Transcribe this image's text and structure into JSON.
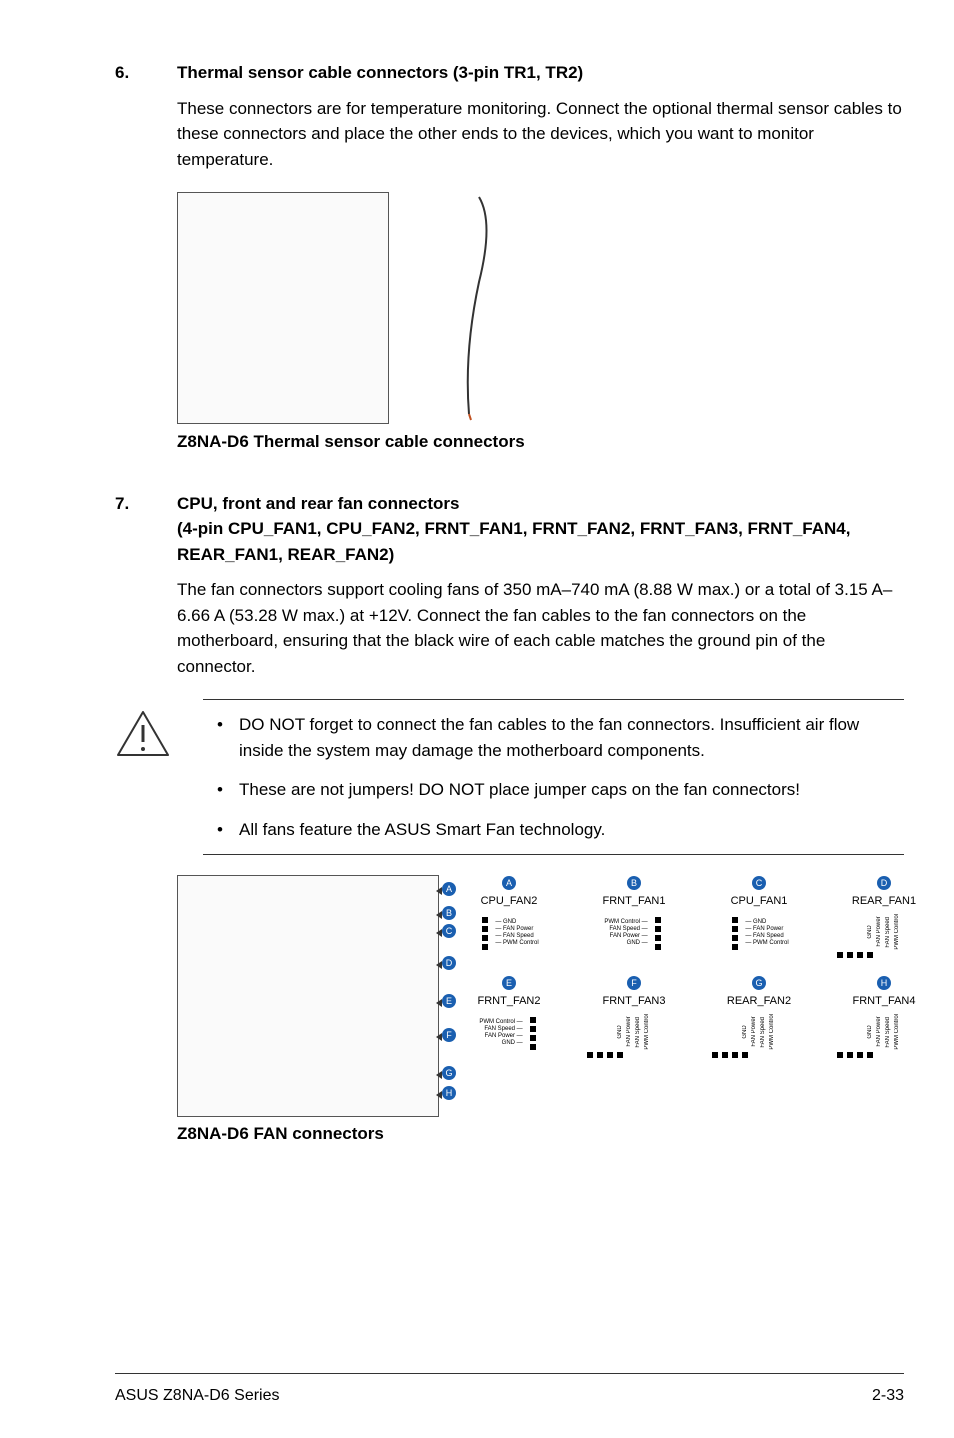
{
  "sec6": {
    "num": "6.",
    "title": "Thermal sensor cable connectors (3-pin TR1, TR2)",
    "body": "These connectors are for temperature monitoring. Connect the optional thermal sensor cables to these connectors and place the other ends to the devices, which you want to monitor temperature.",
    "caption": "Z8NA-D6 Thermal sensor cable connectors"
  },
  "sec7": {
    "num": "7.",
    "title1": "CPU, front and rear fan connectors",
    "title2": "(4-pin CPU_FAN1, CPU_FAN2, FRNT_FAN1, FRNT_FAN2, FRNT_FAN3, FRNT_FAN4, REAR_FAN1, REAR_FAN2)",
    "body": "The fan connectors support cooling fans of 350 mA–740 mA (8.88 W max.) or a total of 3.15 A–6.66 A (53.28 W max.) at +12V. Connect the fan cables to the fan connectors on the motherboard, ensuring that the black wire of each cable matches the ground pin of the connector.",
    "caption": "Z8NA-D6 FAN connectors"
  },
  "notes": {
    "item1": "DO NOT forget to connect the fan cables to the fan connectors. Insufficient air flow inside the system may damage the motherboard components.",
    "item2": "These are not jumpers! DO NOT place jumper caps on the fan connectors!",
    "item3": "All fans feature the ASUS Smart Fan technology."
  },
  "fans": {
    "row1": [
      {
        "badge": "A",
        "label": "CPU_FAN2",
        "pins": [
          "GND",
          "FAN Power",
          "FAN Speed",
          "PWM Control"
        ],
        "orient": "v-left"
      },
      {
        "badge": "B",
        "label": "FRNT_FAN1",
        "pins": [
          "PWM Control",
          "FAN Speed",
          "FAN Power",
          "GND"
        ],
        "orient": "v-right"
      },
      {
        "badge": "C",
        "label": "CPU_FAN1",
        "pins": [
          "GND",
          "FAN Power",
          "FAN Speed",
          "PWM Control"
        ],
        "orient": "v-left"
      },
      {
        "badge": "D",
        "label": "REAR_FAN1",
        "pins": [
          "GND",
          "FAN Power",
          "FAN Speed",
          "PWM Control"
        ],
        "orient": "h"
      }
    ],
    "row2": [
      {
        "badge": "E",
        "label": "FRNT_FAN2",
        "pins": [
          "PWM Control",
          "FAN Speed",
          "FAN Power",
          "GND"
        ],
        "orient": "v-right"
      },
      {
        "badge": "F",
        "label": "FRNT_FAN3",
        "pins": [
          "GND",
          "FAN Power",
          "FAN Speed",
          "PWM Control"
        ],
        "orient": "h"
      },
      {
        "badge": "G",
        "label": "REAR_FAN2",
        "pins": [
          "GND",
          "FAN Power",
          "FAN Speed",
          "PWM Control"
        ],
        "orient": "h"
      },
      {
        "badge": "H",
        "label": "FRNT_FAN4",
        "pins": [
          "GND",
          "FAN Power",
          "FAN Speed",
          "PWM Control"
        ],
        "orient": "h"
      }
    ],
    "board_callouts": [
      "A",
      "B",
      "C",
      "D",
      "E",
      "F",
      "G",
      "H"
    ]
  },
  "footer": {
    "left": "ASUS Z8NA-D6 Series",
    "right": "2-33"
  }
}
